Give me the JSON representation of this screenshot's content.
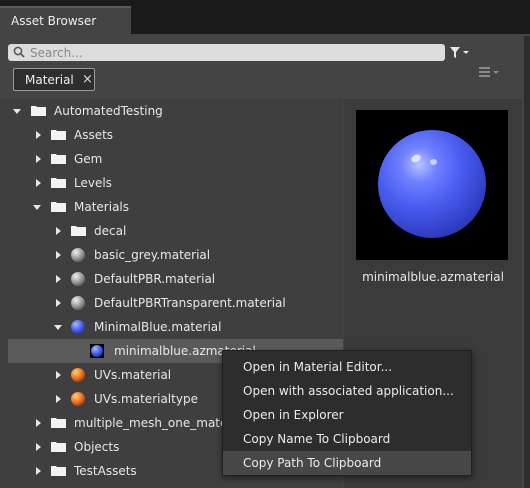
{
  "tab": {
    "title": "Asset Browser"
  },
  "search": {
    "placeholder": "Search..."
  },
  "filter_chip": {
    "label": "Material",
    "remove": "×"
  },
  "tree": [
    {
      "label": "AutomatedTesting",
      "icon": "folder-icon",
      "expander": "expanded"
    },
    {
      "label": "Assets",
      "icon": "folder-icon",
      "expander": "collapsed"
    },
    {
      "label": "Gem",
      "icon": "folder-icon",
      "expander": "collapsed"
    },
    {
      "label": "Levels",
      "icon": "folder-icon",
      "expander": "collapsed"
    },
    {
      "label": "Materials",
      "icon": "folder-icon",
      "expander": "expanded"
    },
    {
      "label": "decal",
      "icon": "folder-icon",
      "expander": "collapsed"
    },
    {
      "label": "basic_grey.material",
      "icon": "grey-material-icon",
      "expander": "collapsed"
    },
    {
      "label": "DefaultPBR.material",
      "icon": "grey-material-icon",
      "expander": "collapsed"
    },
    {
      "label": "DefaultPBRTransparent.material",
      "icon": "grey-material-icon",
      "expander": "collapsed"
    },
    {
      "label": "MinimalBlue.material",
      "icon": "blue-material-icon",
      "expander": "expanded"
    },
    {
      "label": "minimalblue.azmaterial",
      "icon": "blue-material-icon",
      "expander": "none",
      "selected": true
    },
    {
      "label": "UVs.material",
      "icon": "uv-material-icon",
      "expander": "collapsed"
    },
    {
      "label": "UVs.materialtype",
      "icon": "uv-material-icon",
      "expander": "collapsed"
    },
    {
      "label": "multiple_mesh_one_material",
      "icon": "folder-icon",
      "expander": "collapsed"
    },
    {
      "label": "Objects",
      "icon": "folder-icon",
      "expander": "collapsed"
    },
    {
      "label": "TestAssets",
      "icon": "folder-icon",
      "expander": "collapsed"
    }
  ],
  "preview": {
    "name": "minimalblue.azmaterial",
    "image": "blue-sphere-preview"
  },
  "context_menu": [
    {
      "label": "Open in Material Editor..."
    },
    {
      "label": "Open with associated application..."
    },
    {
      "label": "Open in Explorer"
    },
    {
      "label": "Copy Name To Clipboard"
    },
    {
      "label": "Copy Path To Clipboard",
      "highlighted": true
    }
  ],
  "colors": {
    "panel": "#444444",
    "tree_bg": "#3f3f3f",
    "selection": "#5a5a5a",
    "menu_bg": "#2d2d2d",
    "menu_hover": "#474747",
    "material_blue": "#4a5df0"
  }
}
